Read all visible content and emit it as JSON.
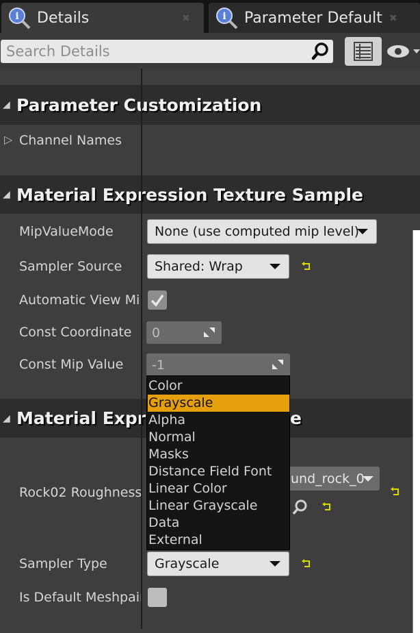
{
  "tabs": [
    {
      "label": "Details",
      "icon": "details-magnifier-icon"
    },
    {
      "label": "Parameter Defaults",
      "icon": "details-magnifier-icon"
    }
  ],
  "search": {
    "placeholder": "Search Details"
  },
  "sections": {
    "param_customization": {
      "title": "Parameter Customization"
    },
    "texture_sample": {
      "title": "Material Expression Texture Sample"
    },
    "third": {
      "title_visible_left": "Material Expres",
      "title_visible_right": "e"
    }
  },
  "rows": {
    "channel_names": "Channel Names",
    "mip_value_mode": {
      "label": "MipValueMode",
      "value": "None (use computed mip level)"
    },
    "sampler_source": {
      "label": "Sampler Source",
      "value": "Shared: Wrap"
    },
    "automatic_view_mip": {
      "label": "Automatic View Mip",
      "checked": true
    },
    "const_coordinate": {
      "label": "Const Coordinate",
      "value": "0"
    },
    "const_mip_value": {
      "label": "Const Mip Value",
      "value": "-1"
    },
    "rock_roughness": {
      "label": "Rock02 Roughness",
      "asset_value_partial": "und_rock_0"
    },
    "sampler_type": {
      "label": "Sampler Type",
      "value": "Grayscale"
    },
    "is_default_meshpaint": {
      "label": "Is Default Meshpaint",
      "checked": false
    }
  },
  "sampler_type_menu": {
    "selected_index": 1,
    "options": [
      "Color",
      "Grayscale",
      "Alpha",
      "Normal",
      "Masks",
      "Distance Field Font",
      "Linear Color",
      "Linear Grayscale",
      "Data",
      "External"
    ]
  },
  "colors": {
    "selection_highlight": "#e7a00d",
    "reset_arrow": "#d8d800",
    "section_bg": "#2d2d2d",
    "panel_bg": "#3e3e3e"
  }
}
